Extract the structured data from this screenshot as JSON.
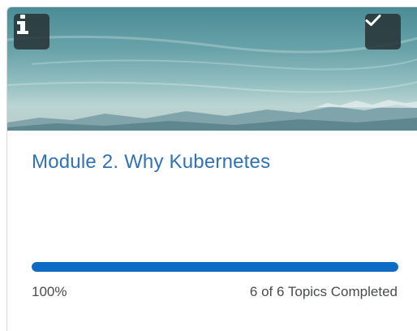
{
  "card": {
    "title": "Module 2. Why Kubernetes",
    "progress": {
      "fraction": 1.0,
      "percent_label": "100%",
      "topics_label": "6 of 6 Topics Completed"
    },
    "info_icon": "info-icon",
    "complete_icon": "checkmark-icon"
  },
  "colors": {
    "title": "#2f72b5",
    "progress_fill": "#0d6bc3",
    "text": "#494c4e"
  }
}
